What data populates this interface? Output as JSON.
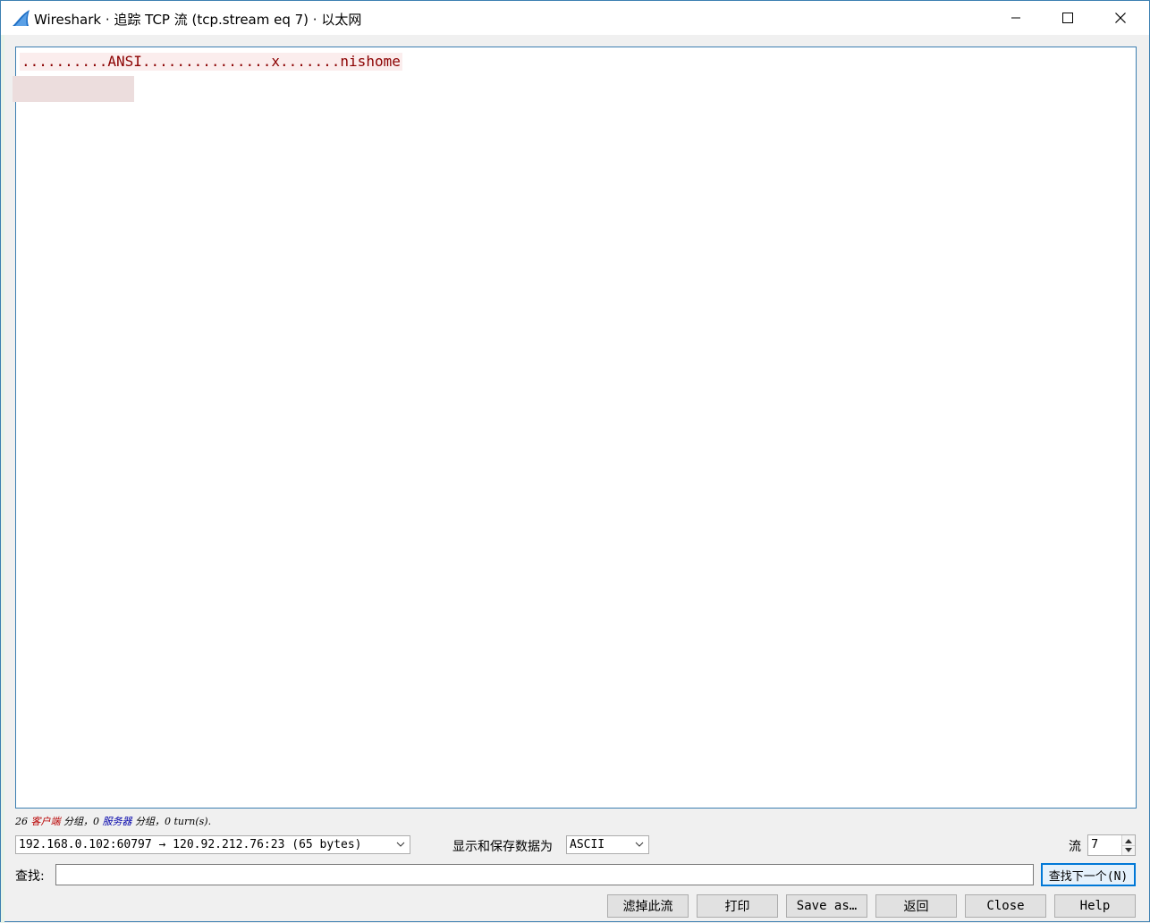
{
  "window": {
    "title": "Wireshark · 追踪 TCP 流 (tcp.stream eq 7) · 以太网"
  },
  "stream": {
    "text": "..........ANSI...............x.......nishome"
  },
  "status": {
    "count_client": "26 ",
    "client_label": "客户端",
    "middle": " 分组，0 ",
    "server_label": "服务器",
    "tail": " 分组，0 turn(s)."
  },
  "controls": {
    "conversation_value": "192.168.0.102:60797 → 120.92.212.76:23 (65 bytes)",
    "format_label": "显示和保存数据为",
    "format_value": "ASCII",
    "stream_label": "流",
    "stream_value": "7",
    "find_label": "查找:",
    "find_value": "",
    "find_next_label": "查找下一个(N)"
  },
  "buttons": {
    "filter_out": "滤掉此流",
    "print": "打印",
    "save_as": "Save as…",
    "back": "返回",
    "close": "Close",
    "help": "Help"
  },
  "colors": {
    "client_text": "#8b0000",
    "client_bg": "#fbeded",
    "accent": "#0078d7"
  }
}
